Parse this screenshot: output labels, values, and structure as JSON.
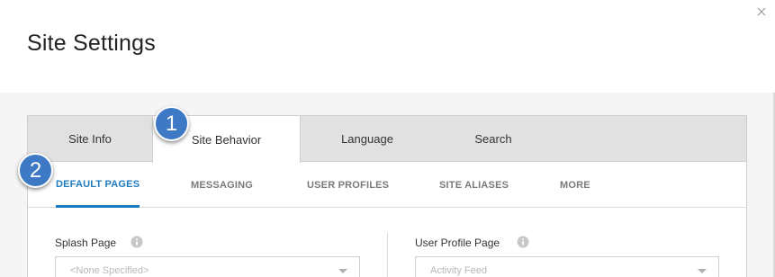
{
  "dialog": {
    "title": "Site Settings"
  },
  "tabs": [
    {
      "label": "Site Info"
    },
    {
      "label": "Site Behavior"
    },
    {
      "label": "Language"
    },
    {
      "label": "Search"
    }
  ],
  "active_tab": "Site Behavior",
  "subtabs": [
    {
      "label": "DEFAULT PAGES"
    },
    {
      "label": "MESSAGING"
    },
    {
      "label": "USER PROFILES"
    },
    {
      "label": "SITE ALIASES"
    },
    {
      "label": "MORE"
    }
  ],
  "active_subtab": "DEFAULT PAGES",
  "fields": {
    "splash_page": {
      "label": "Splash Page",
      "value": "<None Specified>"
    },
    "user_profile_page": {
      "label": "User Profile Page",
      "value": "Activity Feed"
    }
  },
  "callouts": [
    {
      "number": "1"
    },
    {
      "number": "2"
    }
  ],
  "colors": {
    "accent": "#1f7bc0",
    "callout": "#3d79c4"
  },
  "icons": {
    "close": "close-icon",
    "info": "info-icon",
    "dropdown": "chevron-down-icon"
  }
}
